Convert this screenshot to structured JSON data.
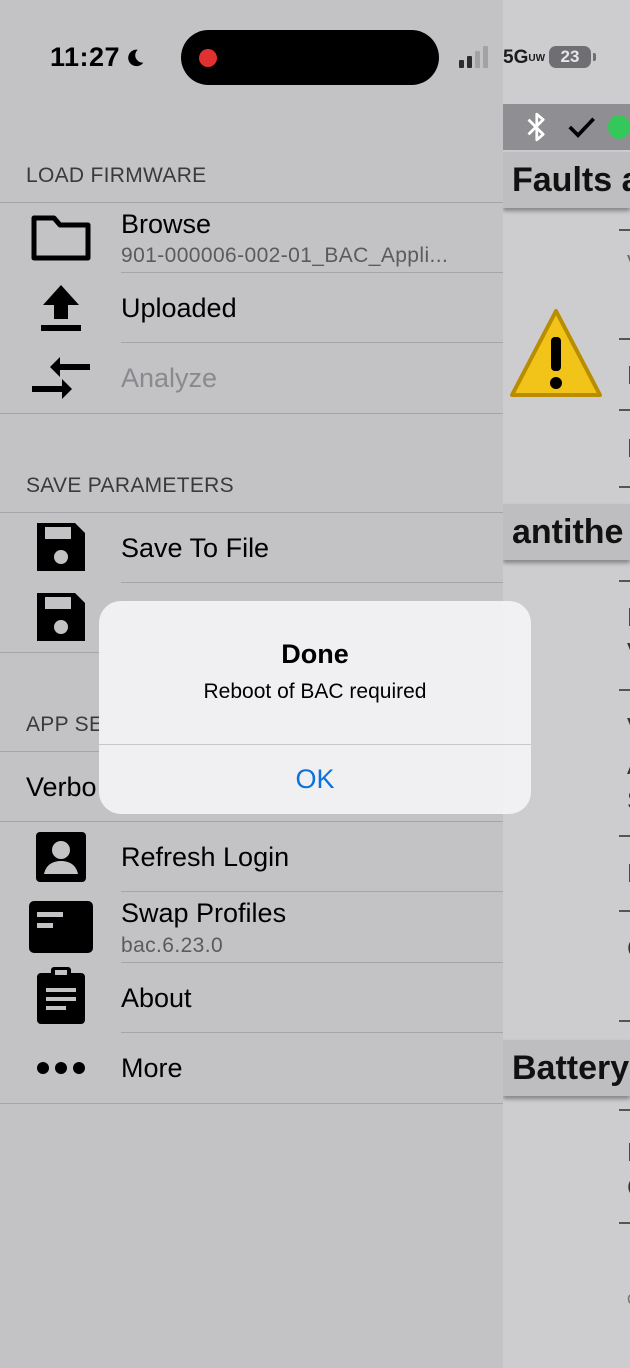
{
  "status_bar": {
    "time": "11:27",
    "network": "5G",
    "network_suffix": "UW",
    "battery": "23"
  },
  "drawer": {
    "load_firmware": {
      "header": "LOAD FIRMWARE",
      "browse_label": "Browse",
      "browse_file": "901-000006-002-01_BAC_Appli...",
      "uploaded_label": "Uploaded",
      "analyze_label": "Analyze"
    },
    "save_parameters": {
      "header": "SAVE PARAMETERS",
      "save_to_file_label": "Save To File"
    },
    "app_settings": {
      "header_visible": "APP SE",
      "verbose_visible": "Verbo",
      "refresh_login_label": "Refresh Login",
      "swap_profiles_label": "Swap Profiles",
      "profile_version": "bac.6.23.0",
      "about_label": "About",
      "more_label": "More"
    }
  },
  "right_pane": {
    "headings": [
      "Faults a",
      "antithe",
      "Battery"
    ],
    "icons": [
      "bluetooth-icon",
      "check-icon",
      "connected-dot-icon",
      "warning-icon"
    ]
  },
  "alert": {
    "title": "Done",
    "message": "Reboot of BAC required",
    "ok_label": "OK"
  },
  "colors": {
    "alert_button": "#0a72dd",
    "recording_dot": "#e03131",
    "connected_dot": "#34c759",
    "warning_fill": "#f2c318"
  }
}
